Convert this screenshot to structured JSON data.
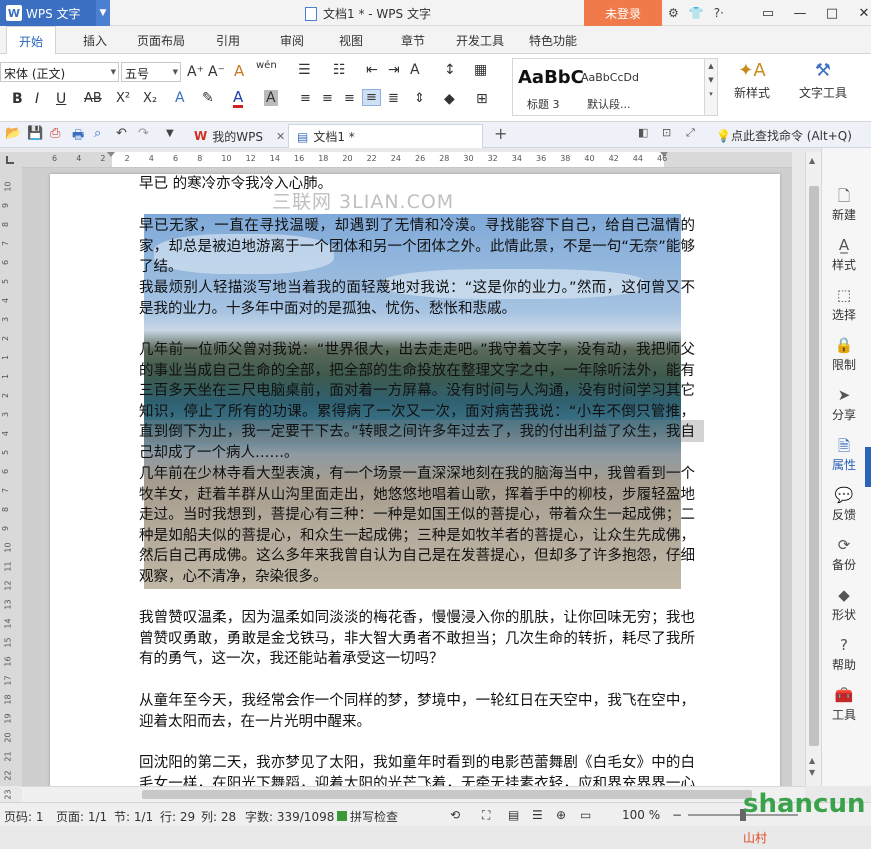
{
  "app": {
    "name": "WPS 文字",
    "window_title": "文档1 * - WPS 文字",
    "login": "未登录"
  },
  "title_icons": [
    "gear-icon",
    "shirt-icon",
    "help-icon"
  ],
  "window_controls": {
    "restore": "▭",
    "minimize": "—",
    "maximize": "□",
    "close": "✕"
  },
  "menu": [
    "开始",
    "插入",
    "页面布局",
    "引用",
    "审阅",
    "视图",
    "章节",
    "开发工具",
    "特色功能"
  ],
  "ribbon": {
    "font_name": "宋体 (正文)",
    "font_size": "五号",
    "font_grow": "A⁺",
    "font_shrink": "A⁻",
    "clear_format": "A",
    "phonetic": "wén",
    "bold": "B",
    "italic": "I",
    "underline": "U",
    "strikethrough": "AB",
    "superscript": "X²",
    "subscript": "X₂",
    "styles": {
      "sample1": "AaBbC",
      "sample2": "AaBbCcDd",
      "label1": "标题 3",
      "label2": "默认段..."
    },
    "new_style": "新样式",
    "text_tools": "文字工具"
  },
  "tabs_bar": {
    "home_tab": "我的WPS",
    "doc_tab": "文档1 *",
    "add": "+",
    "hint": "点此查找命令 (Alt+Q)"
  },
  "ruler_h": [
    "6",
    "4",
    "2",
    "2",
    "4",
    "6",
    "8",
    "10",
    "12",
    "14",
    "16",
    "18",
    "20",
    "22",
    "24",
    "26",
    "28",
    "30",
    "32",
    "34",
    "36",
    "38",
    "40",
    "42",
    "44",
    "46"
  ],
  "ruler_v": [
    "10",
    "9",
    "8",
    "7",
    "6",
    "5",
    "4",
    "3",
    "2",
    "1",
    "1",
    "2",
    "3",
    "4",
    "5",
    "6",
    "7",
    "8",
    "9",
    "10",
    "11",
    "12",
    "13",
    "14",
    "15",
    "16",
    "17",
    "18",
    "19",
    "20",
    "21",
    "22",
    "23"
  ],
  "document": {
    "watermark": "三联网 3LIAN.COM",
    "paragraphs": [
      "早已 的寒冷亦令我冷入心肺。",
      "早已无家，一直在寻找温暖，却遇到了无情和冷漠。寻找能容下自己，给自己温情的家，却总是被迫地游离于一个团体和另一个团体之外。此情此景，不是一句“无奈”能够了结。",
      "我最烦别人轻描淡写地当着我的面轻蔑地对我说：“这是你的业力。”然而，这何曾又不是我的业力。十多年中面对的是孤独、忧伤、愁怅和悲戚。",
      "几年前一位师父曾对我说：“世界很大，出去走走吧。”我守着文字，没有动，我把师父的事业当成自己生命的全部，把全部的生命投放在整理文字之中，一年除听法外，能有三百多天坐在三尺电脑桌前，面对着一方屏幕。没有时间与人沟通，没有时间学习其它知识，停止了所有的功课。累得病了一次又一次，面对病苦我说：“小车不倒只管推，直到倒下为止，我一定要干下去。”转眼之间许多年过去了，我的付出利益了众生，我自己却成了一个病人……。",
      "几年前在少林寺看大型表演，有一个场景一直深深地刻在我的脑海当中，我曾看到一个牧羊女，赶着羊群从山沟里面走出，她悠悠地唱着山歌，挥着手中的柳枝，步履轻盈地走过。当时我想到，菩提心有三种：一种是如国王似的菩提心，带着众生一起成佛；二种是如船夫似的菩提心，和众生一起成佛；三种是如牧羊者的菩提心，让众生先成佛，然后自己再成佛。这么多年来我曾自认为自己是在发菩提心，但却多了许多抱怨，仔细观察，心不清净，杂染很多。",
      "我曾赞叹温柔，因为温柔如同淡淡的梅花香，慢慢浸入你的肌肤，让你回味无穷；我也曾赞叹勇敢，勇敢是金戈铁马，非大智大勇者不敢担当；几次生命的转折，耗尽了我所有的勇气，这一次，我还能站着承受这一切吗？",
      "从童年至今天，我经常会作一个同样的梦，梦境中，一轮红日在天空中，我飞在空中，迎着太阳而去，在一片光明中醒来。",
      "回沈阳的第二天，我亦梦见了太阳，我如童年时看到的电影芭蕾舞剧《白毛女》中的白毛女一样，在阳光下舞蹈，迎着太阳的光芒飞着，无牵无挂素衣轻，应和界充界界一心在无限的"
    ]
  },
  "side_panel": [
    {
      "icon": "new-doc-icon",
      "label": "新建"
    },
    {
      "icon": "style-icon",
      "label": "样式"
    },
    {
      "icon": "select-icon",
      "label": "选择"
    },
    {
      "icon": "restrict-icon",
      "label": "限制"
    },
    {
      "icon": "share-icon",
      "label": "分享"
    },
    {
      "icon": "properties-icon",
      "label": "属性"
    },
    {
      "icon": "feedback-icon",
      "label": "反馈"
    },
    {
      "icon": "backup-icon",
      "label": "备份"
    },
    {
      "icon": "shape-icon",
      "label": "形状"
    },
    {
      "icon": "help-icon",
      "label": "帮助"
    },
    {
      "icon": "toolbox-icon",
      "label": "工具"
    }
  ],
  "status": {
    "page_code": "页码: 1",
    "page": "页面: 1/1",
    "section": "节: 1/1",
    "row": "行: 29",
    "col": "列: 28",
    "words": "字数: 339/1098",
    "spell": "拼写检查",
    "zoom": "100 %",
    "zoom_level": 0.5
  },
  "brand": {
    "text": "shancun",
    "sub": "山村"
  }
}
